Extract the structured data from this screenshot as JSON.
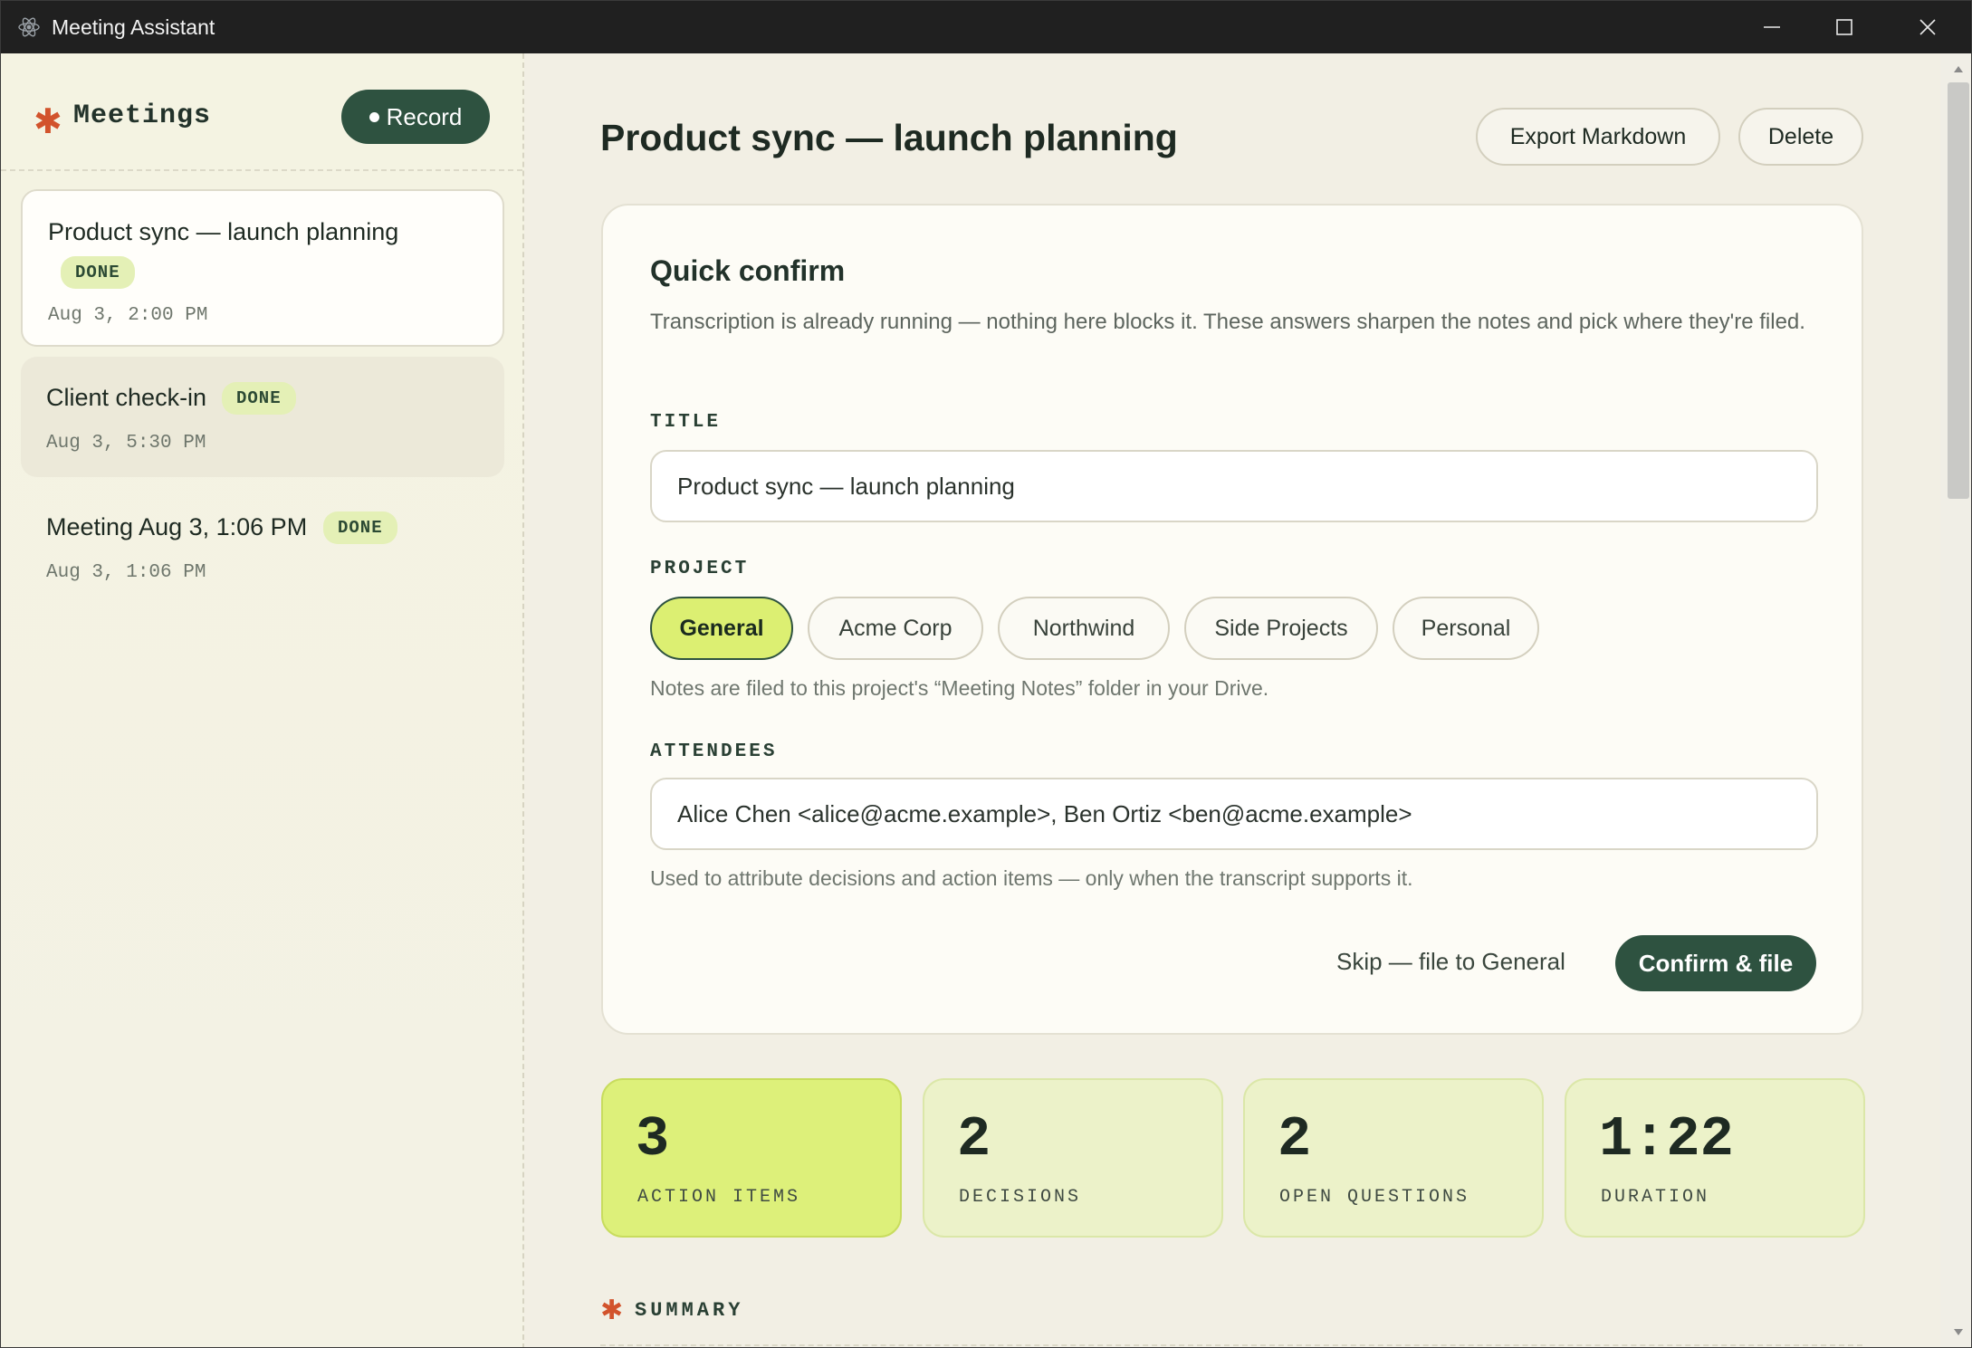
{
  "window": {
    "title": "Meeting Assistant"
  },
  "sidebar": {
    "title": "Meetings",
    "record_label": "Record",
    "meetings": [
      {
        "title": "Product sync — launch planning",
        "status": "DONE",
        "date": "Aug 3, 2:00 PM"
      },
      {
        "title": "Client check-in",
        "status": "DONE",
        "date": "Aug 3, 5:30 PM"
      },
      {
        "title": "Meeting Aug 3, 1:06 PM",
        "status": "DONE",
        "date": "Aug 3, 1:06 PM"
      }
    ]
  },
  "main": {
    "title": "Product sync — launch planning",
    "export_label": "Export Markdown",
    "delete_label": "Delete",
    "quick_confirm": {
      "heading": "Quick confirm",
      "description": "Transcription is already running — nothing here blocks it. These answers sharpen the notes and pick where they're filed.",
      "title_label": "TITLE",
      "title_value": "Product sync — launch planning",
      "project_label": "PROJECT",
      "projects": [
        "General",
        "Acme Corp",
        "Northwind",
        "Side Projects",
        "Personal"
      ],
      "selected_project": "General",
      "project_hint": "Notes are filed to this project's “Meeting Notes” folder in your Drive.",
      "attendees_label": "ATTENDEES",
      "attendees_value": "Alice Chen <alice@acme.example>, Ben Ortiz <ben@acme.example>",
      "attendees_hint": "Used to attribute decisions and action items — only when the transcript supports it.",
      "skip_label": "Skip — file to General",
      "confirm_label": "Confirm & file"
    },
    "stats": [
      {
        "value": "3",
        "label": "ACTION ITEMS"
      },
      {
        "value": "2",
        "label": "DECISIONS"
      },
      {
        "value": "2",
        "label": "OPEN QUESTIONS"
      },
      {
        "value": "1:22",
        "label": "DURATION"
      }
    ],
    "summary_label": "SUMMARY"
  },
  "colors": {
    "accent_dark_green": "#2e5240",
    "accent_lime": "#dcef72",
    "star_orange": "#d2532c"
  },
  "icons": [
    "electron-icon",
    "minimize-icon",
    "maximize-icon",
    "close-icon",
    "asterisk-icon"
  ]
}
